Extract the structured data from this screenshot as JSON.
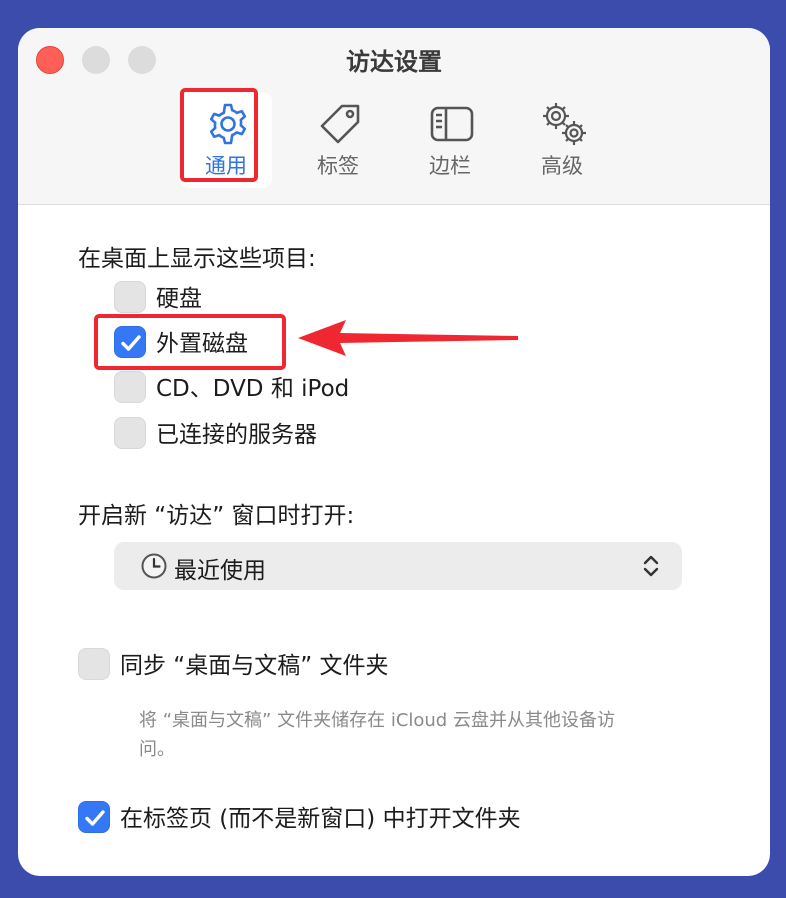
{
  "window": {
    "title": "访达设置"
  },
  "tabs": [
    {
      "label": "通用",
      "icon": "gear-icon",
      "selected": true
    },
    {
      "label": "标签",
      "icon": "tag-icon",
      "selected": false
    },
    {
      "label": "边栏",
      "icon": "sidebar-icon",
      "selected": false
    },
    {
      "label": "高级",
      "icon": "gears-icon",
      "selected": false
    }
  ],
  "desktop_section": {
    "heading": "在桌面上显示这些项目:",
    "items": [
      {
        "label": "硬盘",
        "checked": false
      },
      {
        "label": "外置磁盘",
        "checked": true
      },
      {
        "label": "CD、DVD 和 iPod",
        "checked": false
      },
      {
        "label": "已连接的服务器",
        "checked": false
      }
    ]
  },
  "new_window_section": {
    "heading": "开启新 “访达” 窗口时打开:",
    "popup_value": "最近使用",
    "popup_icon": "clock-icon"
  },
  "sync": {
    "label": "同步 “桌面与文稿” 文件夹",
    "checked": false,
    "help": "将 “桌面与文稿” 文件夹储存在 iCloud 云盘并从其他设备访问。"
  },
  "tabs_option": {
    "label": "在标签页 (而不是新窗口) 中打开文件夹",
    "checked": true
  },
  "colors": {
    "accent": "#3478f6",
    "annotation": "#ee2730",
    "background": "#3c4cad"
  }
}
